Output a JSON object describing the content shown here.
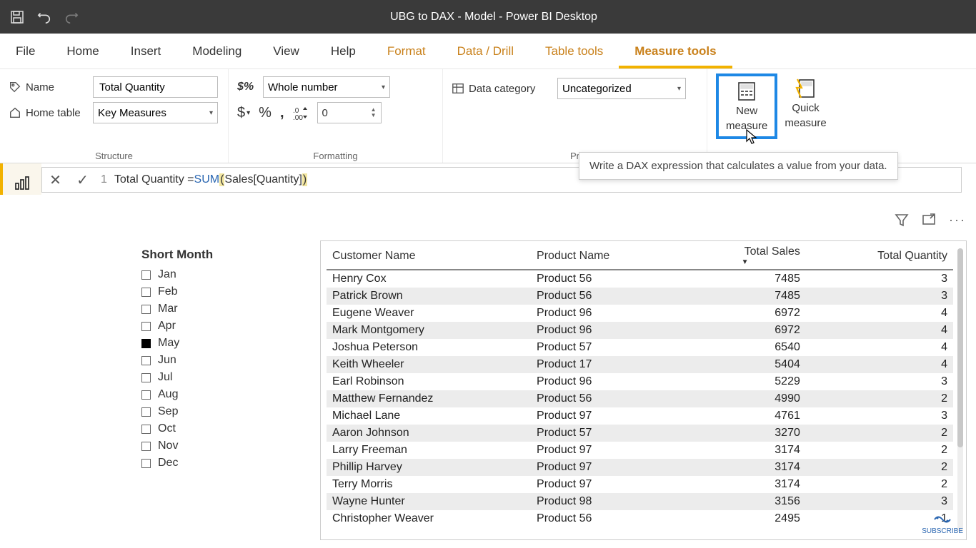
{
  "title": "UBG to DAX - Model - Power BI Desktop",
  "tabs": {
    "file": "File",
    "home": "Home",
    "insert": "Insert",
    "modeling": "Modeling",
    "view": "View",
    "help": "Help",
    "format": "Format",
    "datadrill": "Data / Drill",
    "tabletools": "Table tools",
    "measuretools": "Measure tools"
  },
  "ribbon": {
    "name_label": "Name",
    "name_value": "Total Quantity",
    "home_table_label": "Home table",
    "home_table_value": "Key Measures",
    "structure_label": "Structure",
    "format_select": "Whole number",
    "decimals_value": "0",
    "formatting_label": "Formatting",
    "data_category_label": "Data category",
    "data_category_value": "Uncategorized",
    "properties_label": "Pr",
    "new_measure": "New measure",
    "quick_measure": "Quick measure",
    "new_measure_line1": "New",
    "new_measure_line2": "measure",
    "quick_measure_line1": "Quick",
    "quick_measure_line2": "measure"
  },
  "tooltip": "Write a DAX expression that calculates a value from your data.",
  "formula": {
    "line_no": "1",
    "lhs": "Total Quantity = ",
    "func": "SUM",
    "arg": " Sales[Quantity] "
  },
  "slicer": {
    "title": "Short Month",
    "items": [
      {
        "label": "Jan",
        "checked": false
      },
      {
        "label": "Feb",
        "checked": false
      },
      {
        "label": "Mar",
        "checked": false
      },
      {
        "label": "Apr",
        "checked": false
      },
      {
        "label": "May",
        "checked": true
      },
      {
        "label": "Jun",
        "checked": false
      },
      {
        "label": "Jul",
        "checked": false
      },
      {
        "label": "Aug",
        "checked": false
      },
      {
        "label": "Sep",
        "checked": false
      },
      {
        "label": "Oct",
        "checked": false
      },
      {
        "label": "Nov",
        "checked": false
      },
      {
        "label": "Dec",
        "checked": false
      }
    ]
  },
  "table": {
    "columns": [
      "Customer Name",
      "Product Name",
      "Total Sales",
      "Total Quantity"
    ],
    "sort_col": 2,
    "rows": [
      [
        "Henry Cox",
        "Product 56",
        "7485",
        "3"
      ],
      [
        "Patrick Brown",
        "Product 56",
        "7485",
        "3"
      ],
      [
        "Eugene Weaver",
        "Product 96",
        "6972",
        "4"
      ],
      [
        "Mark Montgomery",
        "Product 96",
        "6972",
        "4"
      ],
      [
        "Joshua Peterson",
        "Product 57",
        "6540",
        "4"
      ],
      [
        "Keith Wheeler",
        "Product 17",
        "5404",
        "4"
      ],
      [
        "Earl Robinson",
        "Product 96",
        "5229",
        "3"
      ],
      [
        "Matthew Fernandez",
        "Product 56",
        "4990",
        "2"
      ],
      [
        "Michael Lane",
        "Product 97",
        "4761",
        "3"
      ],
      [
        "Aaron Johnson",
        "Product 57",
        "3270",
        "2"
      ],
      [
        "Larry Freeman",
        "Product 97",
        "3174",
        "2"
      ],
      [
        "Phillip Harvey",
        "Product 97",
        "3174",
        "2"
      ],
      [
        "Terry Morris",
        "Product 97",
        "3174",
        "2"
      ],
      [
        "Wayne Hunter",
        "Product 98",
        "3156",
        "3"
      ],
      [
        "Christopher Weaver",
        "Product 56",
        "2495",
        "1"
      ]
    ]
  },
  "subscribe_label": "SUBSCRIBE"
}
